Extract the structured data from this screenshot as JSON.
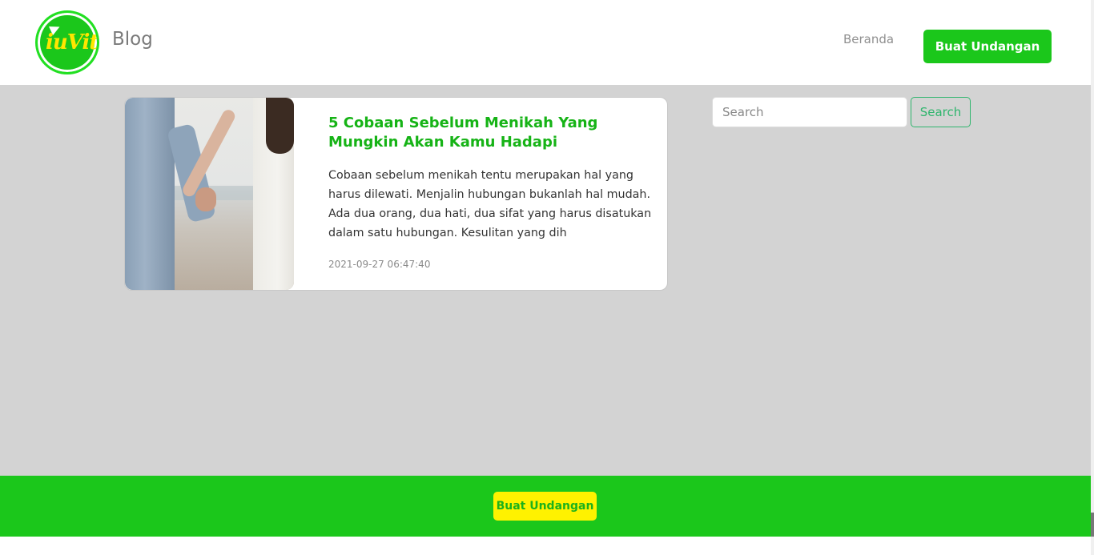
{
  "header": {
    "logo_text": "iuVit",
    "brand": "Blog",
    "nav_link": "Beranda",
    "cta_label": "Buat Undangan"
  },
  "post": {
    "title": "5 Cobaan Sebelum Menikah Yang Mungkin Akan Kamu Hadapi",
    "excerpt": "Cobaan sebelum menikah tentu merupakan hal yang harus dilewati. Menjalin hubungan bukanlah hal mudah. Ada dua orang, dua hati, dua sifat yang harus disatukan dalam satu hubungan. Kesulitan yang dih",
    "date": "2021-09-27 06:47:40"
  },
  "search": {
    "placeholder": "Search",
    "button_label": "Search"
  },
  "footer": {
    "cta_label": "Buat Undangan"
  },
  "colors": {
    "brand_green": "#1bc71b",
    "title_green": "#16b316",
    "footer_button_yellow": "#fff200",
    "content_background": "#d3d3d3"
  }
}
